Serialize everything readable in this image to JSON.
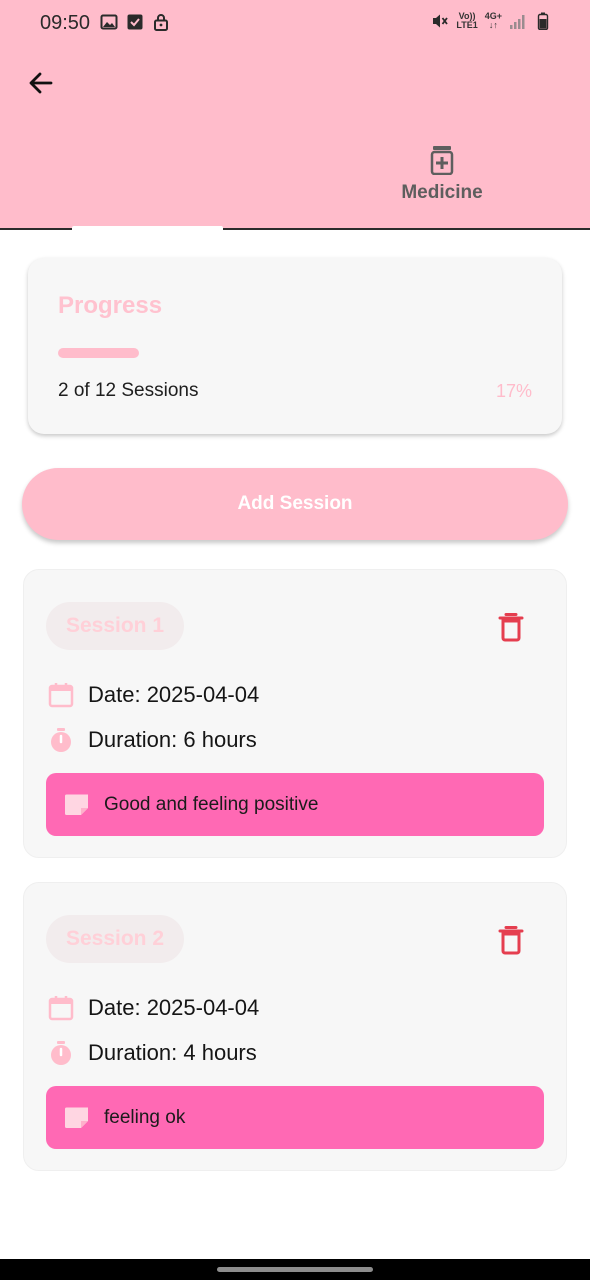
{
  "status_bar": {
    "time": "09:50",
    "left_icons": [
      "image-icon",
      "checkbox-icon",
      "lock-icon"
    ],
    "right_icons": [
      "mute-icon",
      "volte-icon",
      "4g-signal-icon",
      "signal-icon",
      "battery-icon"
    ],
    "volte_label_top": "Vo))",
    "volte_label_bottom": "LTE1",
    "net_label_top": "4G+",
    "net_label_bottom": "↓↑"
  },
  "header": {
    "background": "#ffbccb",
    "back_icon": "arrow-left-icon",
    "tabs": [
      {
        "label": "",
        "icon": "",
        "selected": true
      },
      {
        "label": "Medicine",
        "icon": "medicine-bottle-icon",
        "selected": false
      }
    ]
  },
  "progress": {
    "title": "Progress",
    "completed": 2,
    "total": 12,
    "fraction": 0.17,
    "summary": "2 of 12 Sessions",
    "percent_label": "17%"
  },
  "add_session": {
    "label": "Add Session"
  },
  "sessions": [
    {
      "title": "Session 1",
      "date": "Date: 2025-04-04",
      "duration": "Duration: 6 hours",
      "note": "Good and feeling positive"
    },
    {
      "title": "Session 2",
      "date": "Date: 2025-04-04",
      "duration": "Duration: 4 hours",
      "note": "feeling ok"
    }
  ],
  "colors": {
    "accent_pink": "#ffbccb",
    "note_pink": "#ff69b4",
    "delete_red": "#e53e4f"
  }
}
